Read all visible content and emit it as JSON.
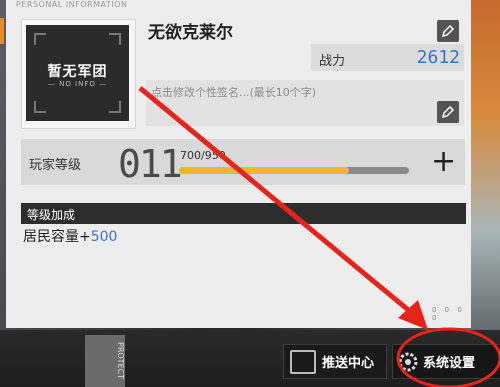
{
  "header": {
    "label": "PERSONAL INFORMATION"
  },
  "avatar": {
    "title": "暂无军团",
    "subtitle": "— NO INFO —"
  },
  "player": {
    "name": "无欲克莱尔"
  },
  "power": {
    "label": "战力",
    "value": "2612"
  },
  "signature": {
    "placeholder": "点击修改个性签名...(最长10个字)"
  },
  "level": {
    "label": "玩家等级",
    "value": "011",
    "exp_text": "700/950",
    "exp_fraction": 0.737
  },
  "bonus": {
    "title": "等级加成",
    "item_label": "居民容量+",
    "item_value": "500"
  },
  "pagination": {
    "dots": "0 0 0 0"
  },
  "bottom": {
    "protect_label": "PROTECT",
    "push_center": "推送中心",
    "system_settings": "系统设置"
  },
  "colors": {
    "accent_blue": "#3e6fd6",
    "exp_bar": "#f5b52a",
    "annotation_red": "#e8231a"
  },
  "icons": {
    "edit": "pencil-icon",
    "plus": "plus-icon",
    "settings": "gear-icon",
    "push": "notification-icon"
  }
}
